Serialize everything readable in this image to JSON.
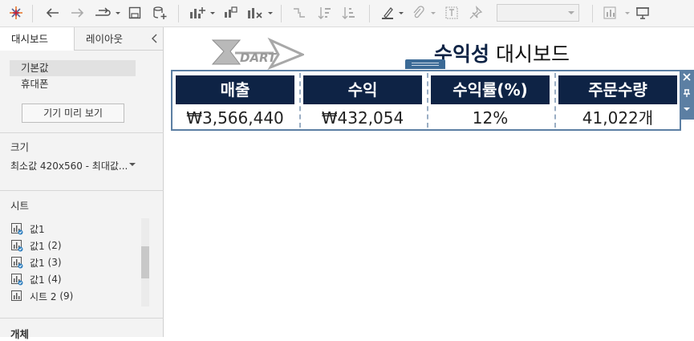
{
  "left_panel": {
    "tabs": [
      {
        "label": "대시보드"
      },
      {
        "label": "레이아웃"
      }
    ],
    "devices": [
      {
        "label": "기본값"
      },
      {
        "label": "휴대폰"
      }
    ],
    "preview_button": "기기 미리 보기",
    "size": {
      "title": "크기",
      "value": "최소값 420x560 - 최대값..."
    },
    "sheets": {
      "title": "시트",
      "items": [
        {
          "name": "값1",
          "count": ""
        },
        {
          "name": "값1",
          "count": "(2)"
        },
        {
          "name": "값1",
          "count": "(3)"
        },
        {
          "name": "값1",
          "count": "(4)"
        },
        {
          "name": "시트 2",
          "count": "(9)"
        }
      ]
    },
    "objects_title": "개체"
  },
  "dashboard": {
    "title_bold": "수익성",
    "title_rest": "대시보드",
    "logo_text": "DART",
    "kpis": [
      {
        "label": "매출",
        "value": "₩3,566,440"
      },
      {
        "label": "수익",
        "value": "₩432,054"
      },
      {
        "label": "수익률(%)",
        "value": "12%"
      },
      {
        "label": "주문수량",
        "value": "41,022개"
      }
    ]
  },
  "colors": {
    "kpi_header": "#0e2345",
    "selection": "#5c7fa3",
    "accent_check": "#2f7fbf"
  }
}
